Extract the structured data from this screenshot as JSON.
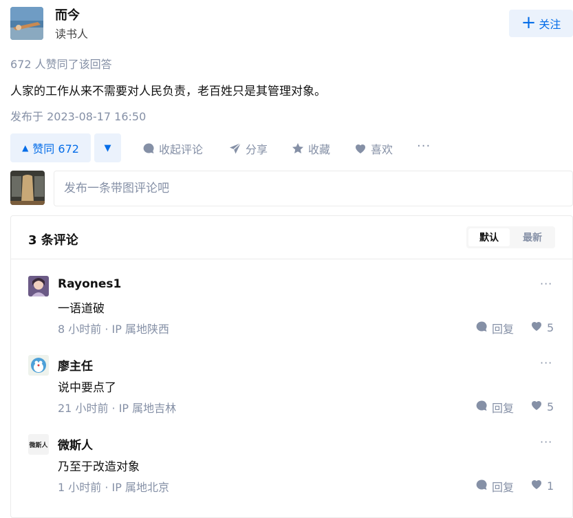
{
  "author": {
    "name": "而今",
    "bio": "读书人",
    "follow_label": "关注"
  },
  "answer": {
    "votes_summary": "672 人赞同了该回答",
    "text": "人家的工作从来不需要对人民负责，老百姓只是其管理对象。",
    "published": "发布于 2023-08-17 16:50"
  },
  "actions": {
    "vote_up_label": "赞同 672",
    "collapse_comments": "收起评论",
    "share": "分享",
    "favorite": "收藏",
    "like": "喜欢",
    "more": "···"
  },
  "comment_input": {
    "placeholder": "发布一条带图评论吧"
  },
  "comments_section": {
    "count_label": "3 条评论",
    "sort_default": "默认",
    "sort_latest": "最新",
    "items": [
      {
        "name": "Rayones1",
        "text": "一语道破",
        "meta": "8 小时前 · IP 属地陕西",
        "reply": "回复",
        "likes": "5"
      },
      {
        "name": "廖主任",
        "text": "说中要点了",
        "meta": "21 小时前 · IP 属地吉林",
        "reply": "回复",
        "likes": "5"
      },
      {
        "name": "微斯人",
        "text": "乃至于改造对象",
        "meta": "1 小时前 · IP 属地北京",
        "reply": "回复",
        "likes": "1"
      }
    ]
  },
  "avatar_logo_text": "微斯人",
  "colors": {
    "brand_blue": "#056de8",
    "brand_blue_bg": "#ebf2fc",
    "meta_gray": "#8590a6",
    "border": "#ebebeb"
  }
}
